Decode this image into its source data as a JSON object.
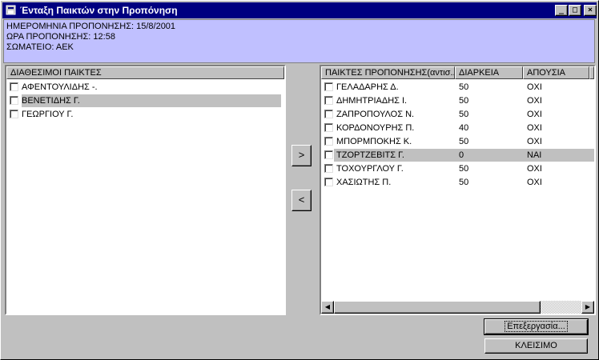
{
  "window": {
    "title": "Ένταξη Παικτών στην Προπόνηση",
    "minimize_glyph": "_",
    "maximize_glyph": "□",
    "close_glyph": "×"
  },
  "info": {
    "date_line": "ΗΜΕΡΟΜΗΝΙΑ ΠΡΟΠΟΝΗΣΗΣ: 15/8/2001",
    "time_line": "ΩΡΑ ΠΡΟΠΟΝΗΣΗΣ: 12:58",
    "club_line": "ΣΩΜΑΤΕΙΟ: ΑΕΚ",
    "background": "#c0c0ff"
  },
  "available": {
    "header": "ΔΙΑΘΕΣΙΜΟΙ ΠΑΙΚΤΕΣ",
    "rows": [
      {
        "name": "ΑΦΕΝΤΟΥΛΙΔΗΣ -."
      },
      {
        "name": "ΒΕΝΕΤΙΔΗΣ Γ."
      },
      {
        "name": "ΓΕΩΡΓΙΟΥ Γ."
      }
    ]
  },
  "transfer": {
    "add_glyph": ">",
    "remove_glyph": "<"
  },
  "training": {
    "headers": {
      "players": "ΠΑΙΚΤΕΣ ΠΡΟΠΟΝΗΣΗΣ(αντισ...",
      "duration": "ΔΙΑΡΚΕΙΑ",
      "absence": "ΑΠΟΥΣΙΑ"
    },
    "rows": [
      {
        "name": "ΓΕΛΑΔΑΡΗΣ Δ.",
        "duration": "50",
        "absence": "ΟΧΙ"
      },
      {
        "name": "ΔΗΜΗΤΡΙΑΔΗΣ Ι.",
        "duration": "50",
        "absence": "ΟΧΙ"
      },
      {
        "name": "ΖΑΠΡΟΠΟΥΛΟΣ Ν.",
        "duration": "50",
        "absence": "ΟΧΙ"
      },
      {
        "name": "ΚΟΡΔΟΝΟΥΡΗΣ Π.",
        "duration": "40",
        "absence": "ΟΧΙ"
      },
      {
        "name": "ΜΠΟΡΜΠΟΚΗΣ Κ.",
        "duration": "50",
        "absence": "ΟΧΙ"
      },
      {
        "name": "ΤΖΟΡΤΖΕΒΙΤΣ Γ.",
        "duration": "0",
        "absence": "ΝΑΙ"
      },
      {
        "name": "ΤΟΧΟΥΡΓΛΟΥ Γ.",
        "duration": "50",
        "absence": "ΟΧΙ"
      },
      {
        "name": "ΧΑΣΙΩΤΗΣ Π.",
        "duration": "50",
        "absence": "ΟΧΙ"
      }
    ],
    "scroll_left_glyph": "◀",
    "scroll_right_glyph": "▶"
  },
  "buttons": {
    "edit": "Επεξεργασία...",
    "close": "ΚΛΕΙΣΙΜΟ"
  },
  "colors": {
    "titlebar": "#000080",
    "selection": "#c0c0c0",
    "face": "#c0c0c0"
  }
}
